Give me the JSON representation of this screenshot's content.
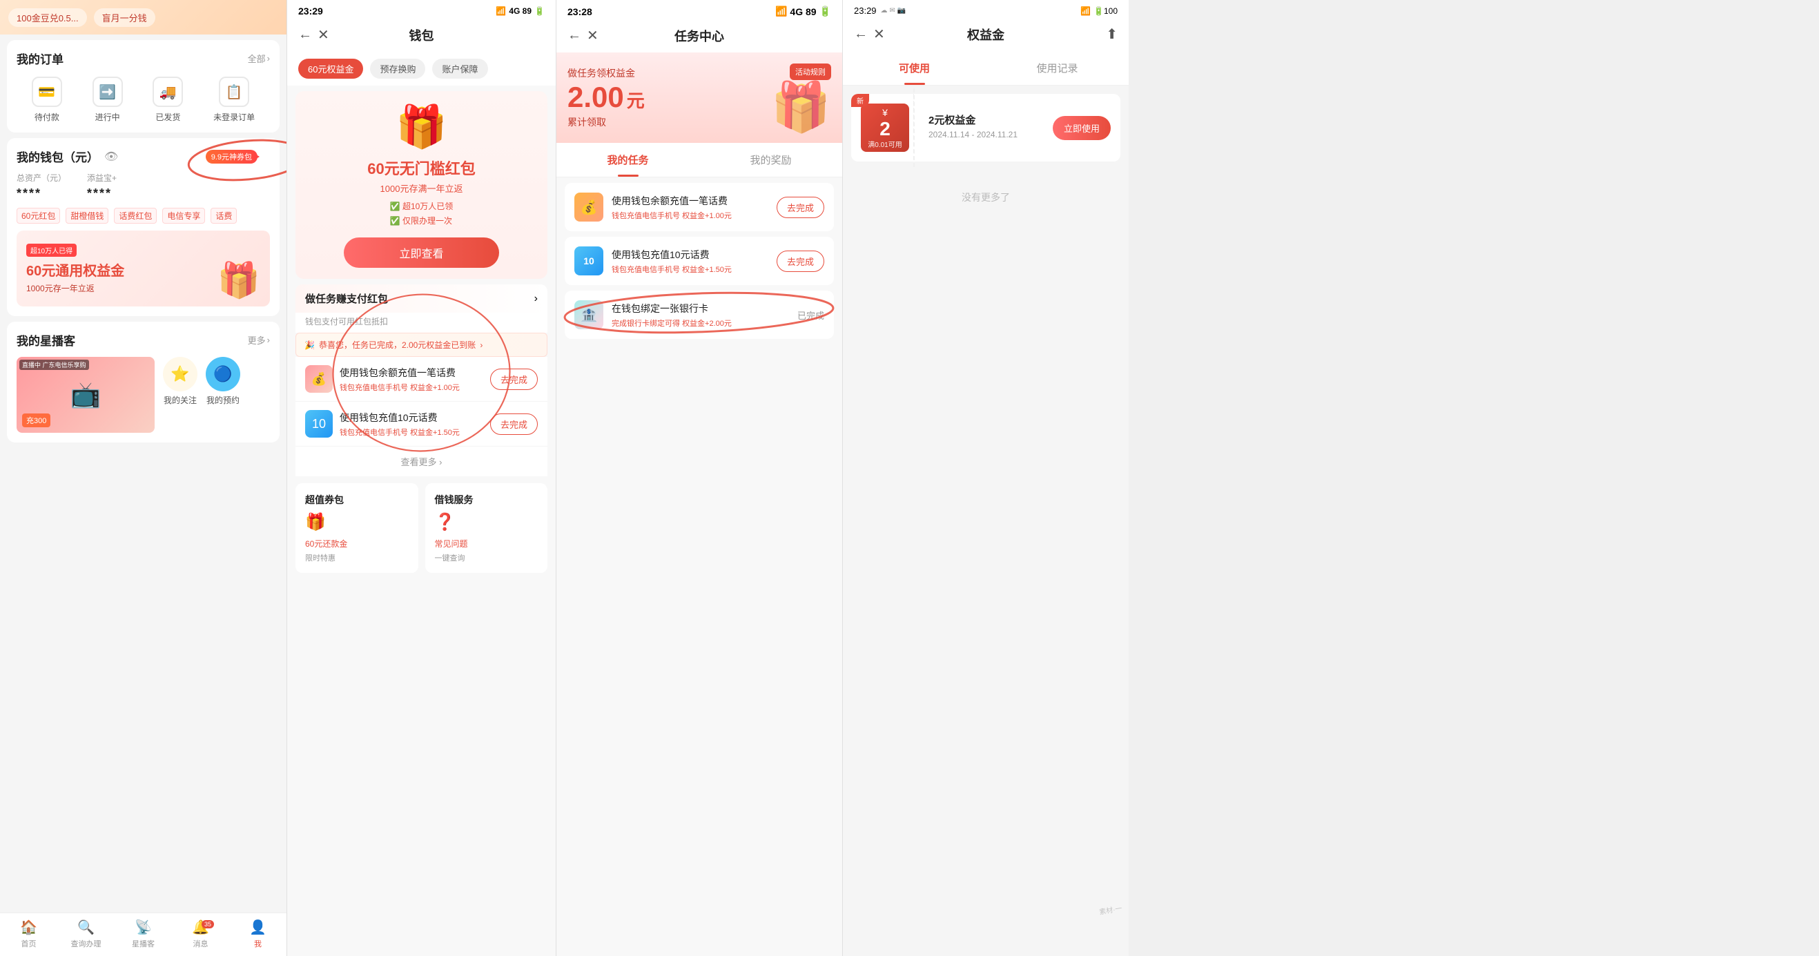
{
  "panel1": {
    "top_banners": [
      "100金豆兑0.5...",
      "盲月一分钱"
    ],
    "orders": {
      "title": "我的订单",
      "link": "全部",
      "items": [
        {
          "label": "待付款",
          "icon": "💳"
        },
        {
          "label": "进行中",
          "icon": "➡️"
        },
        {
          "label": "已发货",
          "icon": "🚚"
        },
        {
          "label": "未登录订单",
          "icon": "📋"
        }
      ]
    },
    "wallet": {
      "title": "我的钱包（元）",
      "badge": "9.9元神券包",
      "total_label": "总资产（元）",
      "tianyibao_label": "添益宝+",
      "total_value": "****",
      "tianyibao_value": "****",
      "tags": [
        "60元红包",
        "甜橙借钱",
        "话费红包",
        "电信专享",
        "话费"
      ],
      "promo": {
        "badge": "超10万人已得",
        "title": "60元通用权益金",
        "subtitle": "1000元存一年立返"
      }
    },
    "star": {
      "title": "我的星播客",
      "link": "更多",
      "thumb_label": "直播中 广东电信乐享购",
      "live_text": "充300",
      "items": [
        {
          "label": "我的关注",
          "icon": "⭐"
        },
        {
          "label": "我的预约",
          "icon": "🔵"
        }
      ]
    },
    "nav": [
      {
        "label": "首页",
        "icon": "🏠",
        "active": false
      },
      {
        "label": "查询办理",
        "icon": "🔍",
        "active": false
      },
      {
        "label": "星播客",
        "icon": "📡",
        "active": false
      },
      {
        "label": "消息",
        "icon": "🔔",
        "active": false
      },
      {
        "label": "我",
        "icon": "👤",
        "active": true
      }
    ]
  },
  "panel2": {
    "status_time": "23:29",
    "status_signal": "4G 89",
    "title": "钱包",
    "back_icon": "←",
    "close_icon": "✕",
    "tabs": [
      {
        "label": "60元权益金",
        "active": true
      },
      {
        "label": "预存换购",
        "active": false
      },
      {
        "label": "账户保障",
        "active": false
      }
    ],
    "hero": {
      "title": "60元无门槛红包",
      "subtitle": "1000元存满一年立返",
      "checks": [
        "超10万人已领",
        "仅限办理一次"
      ],
      "btn_label": "立即查看"
    },
    "task_section": {
      "title": "做任务赚支付红包",
      "subtitle": "钱包支付可用红包抵扣",
      "success_msg": "恭喜您，任务已完成，2.00元权益金已到账",
      "more_link": "查看更多"
    },
    "tasks": [
      {
        "name": "使用钱包余额充值一笔话费",
        "desc": "钱包充值电信手机号",
        "reward": "权益金+1.00元",
        "btn": "去完成"
      },
      {
        "name": "使用钱包充值10元话费",
        "desc": "钱包充值电信手机号",
        "reward": "权益金+1.50元",
        "btn": "去完成"
      }
    ],
    "bottom": {
      "voucher": {
        "title": "超值券包",
        "link": "60元还款金",
        "link_sub": "限时特惠",
        "icon": "🎁"
      },
      "loan": {
        "title": "借钱服务",
        "link": "常见问题",
        "link_sub": "一键查询",
        "icon": "❓"
      }
    }
  },
  "panel3": {
    "status_time": "23:28",
    "status_signal": "4G 89",
    "title": "任务中心",
    "back_icon": "←",
    "close_icon": "✕",
    "hero": {
      "pre_label": "做任务领权益金",
      "amount": "2.00",
      "unit": "元",
      "cumulative_label": "累计领取",
      "activity_badge": "活动规则"
    },
    "tabs": [
      {
        "label": "我的任务",
        "active": true
      },
      {
        "label": "我的奖励",
        "active": false
      }
    ],
    "tasks": [
      {
        "name": "使用钱包余额充值一笔话费",
        "desc": "钱包充值电信手机号",
        "reward": "权益金+1.00元",
        "btn": "去完成",
        "done": false
      },
      {
        "name": "使用钱包充值10元话费",
        "desc": "钱包充值电信手机号",
        "reward": "权益金+1.50元",
        "btn": "去完成",
        "done": false
      },
      {
        "name": "在钱包绑定一张银行卡",
        "desc": "完成银行卡绑定可得",
        "reward": "权益金+2.00元",
        "btn": "",
        "done": true,
        "done_label": "已完成"
      }
    ]
  },
  "panel4": {
    "status_time": "23:29",
    "status_icons": "🔋100",
    "title": "权益金",
    "back_icon": "←",
    "close_icon": "✕",
    "share_icon": "⬆",
    "tabs": [
      {
        "label": "可使用",
        "active": true
      },
      {
        "label": "使用记录",
        "active": false
      }
    ],
    "coupon": {
      "new_badge": "新",
      "symbol": "¥",
      "amount": "2",
      "condition": "满0.01可用",
      "name": "2元权益金",
      "date_start": "2024.11.14",
      "date_end": "2024.11.21",
      "btn_label": "立即使用"
    },
    "empty_msg": "没有更多了"
  },
  "icons": {
    "arrow_right": "›",
    "arrow_left": "‹",
    "back": "‹",
    "close": "✕",
    "share": "⬆",
    "eye_slash": "👁",
    "check": "✓",
    "star": "★",
    "gift": "🎁"
  }
}
